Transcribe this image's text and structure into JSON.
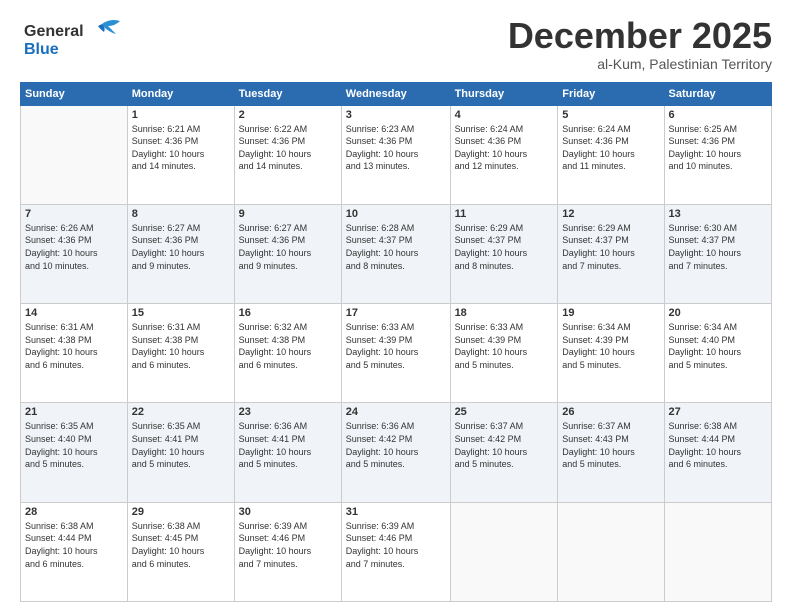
{
  "logo": {
    "line1": "General",
    "line2": "Blue"
  },
  "title": "December 2025",
  "location": "al-Kum, Palestinian Territory",
  "days_of_week": [
    "Sunday",
    "Monday",
    "Tuesday",
    "Wednesday",
    "Thursday",
    "Friday",
    "Saturday"
  ],
  "weeks": [
    [
      {
        "day": "",
        "info": ""
      },
      {
        "day": "1",
        "info": "Sunrise: 6:21 AM\nSunset: 4:36 PM\nDaylight: 10 hours\nand 14 minutes."
      },
      {
        "day": "2",
        "info": "Sunrise: 6:22 AM\nSunset: 4:36 PM\nDaylight: 10 hours\nand 14 minutes."
      },
      {
        "day": "3",
        "info": "Sunrise: 6:23 AM\nSunset: 4:36 PM\nDaylight: 10 hours\nand 13 minutes."
      },
      {
        "day": "4",
        "info": "Sunrise: 6:24 AM\nSunset: 4:36 PM\nDaylight: 10 hours\nand 12 minutes."
      },
      {
        "day": "5",
        "info": "Sunrise: 6:24 AM\nSunset: 4:36 PM\nDaylight: 10 hours\nand 11 minutes."
      },
      {
        "day": "6",
        "info": "Sunrise: 6:25 AM\nSunset: 4:36 PM\nDaylight: 10 hours\nand 10 minutes."
      }
    ],
    [
      {
        "day": "7",
        "info": "Sunrise: 6:26 AM\nSunset: 4:36 PM\nDaylight: 10 hours\nand 10 minutes."
      },
      {
        "day": "8",
        "info": "Sunrise: 6:27 AM\nSunset: 4:36 PM\nDaylight: 10 hours\nand 9 minutes."
      },
      {
        "day": "9",
        "info": "Sunrise: 6:27 AM\nSunset: 4:36 PM\nDaylight: 10 hours\nand 9 minutes."
      },
      {
        "day": "10",
        "info": "Sunrise: 6:28 AM\nSunset: 4:37 PM\nDaylight: 10 hours\nand 8 minutes."
      },
      {
        "day": "11",
        "info": "Sunrise: 6:29 AM\nSunset: 4:37 PM\nDaylight: 10 hours\nand 8 minutes."
      },
      {
        "day": "12",
        "info": "Sunrise: 6:29 AM\nSunset: 4:37 PM\nDaylight: 10 hours\nand 7 minutes."
      },
      {
        "day": "13",
        "info": "Sunrise: 6:30 AM\nSunset: 4:37 PM\nDaylight: 10 hours\nand 7 minutes."
      }
    ],
    [
      {
        "day": "14",
        "info": "Sunrise: 6:31 AM\nSunset: 4:38 PM\nDaylight: 10 hours\nand 6 minutes."
      },
      {
        "day": "15",
        "info": "Sunrise: 6:31 AM\nSunset: 4:38 PM\nDaylight: 10 hours\nand 6 minutes."
      },
      {
        "day": "16",
        "info": "Sunrise: 6:32 AM\nSunset: 4:38 PM\nDaylight: 10 hours\nand 6 minutes."
      },
      {
        "day": "17",
        "info": "Sunrise: 6:33 AM\nSunset: 4:39 PM\nDaylight: 10 hours\nand 5 minutes."
      },
      {
        "day": "18",
        "info": "Sunrise: 6:33 AM\nSunset: 4:39 PM\nDaylight: 10 hours\nand 5 minutes."
      },
      {
        "day": "19",
        "info": "Sunrise: 6:34 AM\nSunset: 4:39 PM\nDaylight: 10 hours\nand 5 minutes."
      },
      {
        "day": "20",
        "info": "Sunrise: 6:34 AM\nSunset: 4:40 PM\nDaylight: 10 hours\nand 5 minutes."
      }
    ],
    [
      {
        "day": "21",
        "info": "Sunrise: 6:35 AM\nSunset: 4:40 PM\nDaylight: 10 hours\nand 5 minutes."
      },
      {
        "day": "22",
        "info": "Sunrise: 6:35 AM\nSunset: 4:41 PM\nDaylight: 10 hours\nand 5 minutes."
      },
      {
        "day": "23",
        "info": "Sunrise: 6:36 AM\nSunset: 4:41 PM\nDaylight: 10 hours\nand 5 minutes."
      },
      {
        "day": "24",
        "info": "Sunrise: 6:36 AM\nSunset: 4:42 PM\nDaylight: 10 hours\nand 5 minutes."
      },
      {
        "day": "25",
        "info": "Sunrise: 6:37 AM\nSunset: 4:42 PM\nDaylight: 10 hours\nand 5 minutes."
      },
      {
        "day": "26",
        "info": "Sunrise: 6:37 AM\nSunset: 4:43 PM\nDaylight: 10 hours\nand 5 minutes."
      },
      {
        "day": "27",
        "info": "Sunrise: 6:38 AM\nSunset: 4:44 PM\nDaylight: 10 hours\nand 6 minutes."
      }
    ],
    [
      {
        "day": "28",
        "info": "Sunrise: 6:38 AM\nSunset: 4:44 PM\nDaylight: 10 hours\nand 6 minutes."
      },
      {
        "day": "29",
        "info": "Sunrise: 6:38 AM\nSunset: 4:45 PM\nDaylight: 10 hours\nand 6 minutes."
      },
      {
        "day": "30",
        "info": "Sunrise: 6:39 AM\nSunset: 4:46 PM\nDaylight: 10 hours\nand 7 minutes."
      },
      {
        "day": "31",
        "info": "Sunrise: 6:39 AM\nSunset: 4:46 PM\nDaylight: 10 hours\nand 7 minutes."
      },
      {
        "day": "",
        "info": ""
      },
      {
        "day": "",
        "info": ""
      },
      {
        "day": "",
        "info": ""
      }
    ]
  ]
}
